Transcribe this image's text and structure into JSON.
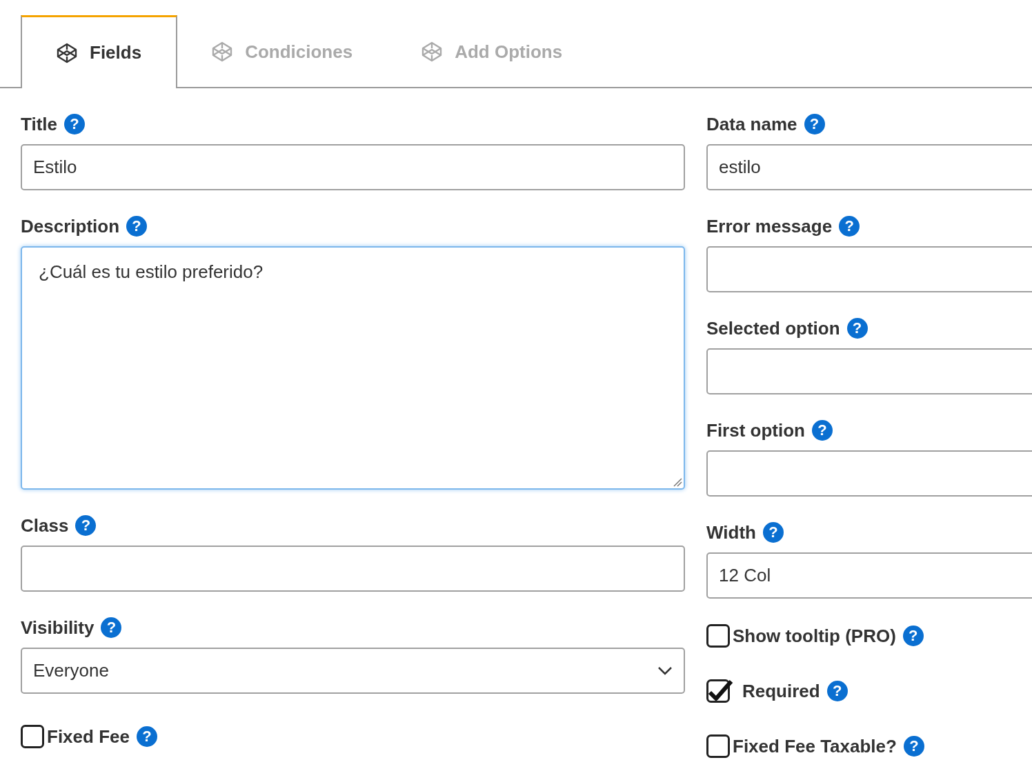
{
  "tabs": [
    {
      "label": "Fields",
      "selected": true
    },
    {
      "label": "Condiciones",
      "selected": false
    },
    {
      "label": "Add Options",
      "selected": false
    }
  ],
  "left_fields": [
    {
      "kind": "text",
      "label": "Title",
      "help": "?",
      "value": "Estilo"
    },
    {
      "kind": "textarea",
      "label": "Description",
      "help": "?",
      "value": "¿Cuál es tu estilo preferido?",
      "focused": true
    },
    {
      "kind": "text",
      "label": "Class",
      "help": "?"
    },
    {
      "kind": "select",
      "label": "Visibility",
      "help": "?",
      "value": "Everyone"
    },
    {
      "kind": "checkbox",
      "label": "Fixed Fee",
      "help": "?",
      "checked": false
    }
  ],
  "right_fields": [
    {
      "kind": "text",
      "label": "Data name",
      "help": "?",
      "value": "estilo"
    },
    {
      "kind": "text",
      "label": "Error message",
      "help": "?"
    },
    {
      "kind": "text",
      "label": "Selected option",
      "help": "?"
    },
    {
      "kind": "text",
      "label": "First option",
      "help": "?"
    },
    {
      "kind": "text",
      "label": "Width",
      "help": "?",
      "value": "12 Col"
    },
    {
      "kind": "checkbox",
      "label": "Show tooltip (PRO)",
      "help": "?",
      "checked": false
    },
    {
      "kind": "checkbox",
      "label": "Required",
      "help": "?",
      "checked": true
    },
    {
      "kind": "checkbox",
      "label": "Fixed Fee Taxable?",
      "help": "?",
      "checked": false
    }
  ]
}
